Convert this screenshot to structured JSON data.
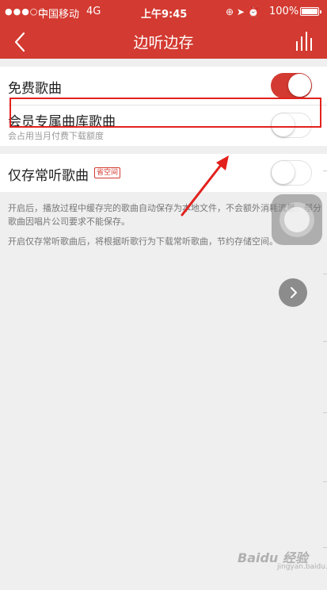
{
  "status_bar": {
    "signal": "●●●○○",
    "carrier": "中国移动",
    "network": "4G",
    "time": "上午9:45",
    "icons": "⊕ ➤ ⏰",
    "battery": "100%"
  },
  "nav": {
    "title": "边听边存",
    "back_icon": "chevron-left-icon",
    "right_icon": "equalizer-icon"
  },
  "settings": {
    "free_songs": {
      "label": "免费歌曲",
      "on": true
    },
    "vip_songs": {
      "label": "会员专属曲库歌曲",
      "sub": "会占用当月付费下载额度",
      "on": false
    },
    "frequent_only": {
      "label": "仅存常听歌曲",
      "tag": "省空间",
      "on": false
    }
  },
  "descriptions": [
    "开启后，播放过程中缓存完的歌曲自动保存为本地文件，不会额外消耗流量。部分歌曲因唱片公司要求不能保存。",
    "开启仅存常听歌曲后，将根据听歌行为下载常听歌曲，节约存储空间。"
  ],
  "watermark": {
    "brand": "Baidu 经验",
    "sub": "jingyan.baidu.com"
  },
  "colors": {
    "accent": "#d33a31",
    "annotation": "#e2211c"
  }
}
